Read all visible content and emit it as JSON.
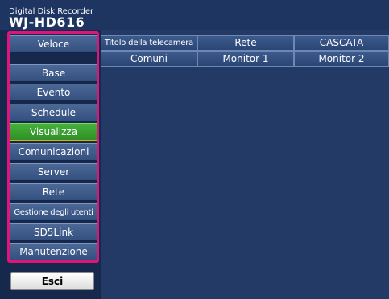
{
  "header": {
    "product": "Digital Disk Recorder",
    "model": "WJ-HD616"
  },
  "sidebar": {
    "veloce": "Veloce",
    "items": [
      {
        "label": "Base"
      },
      {
        "label": "Evento"
      },
      {
        "label": "Schedule"
      },
      {
        "label": "Visualizza",
        "active": true
      },
      {
        "label": "Comunicazioni"
      },
      {
        "label": "Server"
      },
      {
        "label": "Rete"
      },
      {
        "label": "Gestione degli utenti"
      },
      {
        "label": "SD5Link"
      },
      {
        "label": "Manutenzione"
      }
    ],
    "exit_label": "Esci"
  },
  "tabs": {
    "row1": [
      "Titolo della telecamera",
      "Rete",
      "CASCATA"
    ],
    "row2": [
      "Comuni",
      "Monitor 1",
      "Monitor 2"
    ]
  },
  "colors": {
    "background": "#243a66",
    "highlight_frame": "#e0157a",
    "active_item": "#3fa535",
    "active_underline": "#d8b400"
  }
}
